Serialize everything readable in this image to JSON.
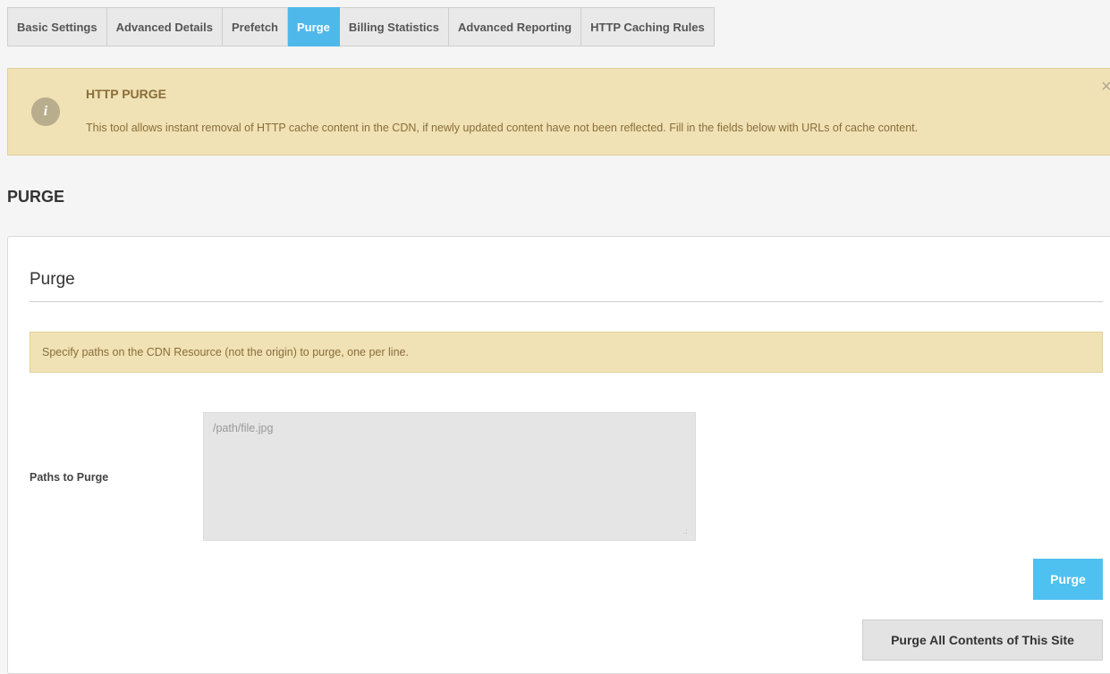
{
  "tabs": [
    {
      "label": "Basic Settings",
      "active": false
    },
    {
      "label": "Advanced Details",
      "active": false
    },
    {
      "label": "Prefetch",
      "active": false
    },
    {
      "label": "Purge",
      "active": true
    },
    {
      "label": "Billing Statistics",
      "active": false
    },
    {
      "label": "Advanced Reporting",
      "active": false
    },
    {
      "label": "HTTP Caching Rules",
      "active": false
    }
  ],
  "alert": {
    "icon": "info-icon",
    "icon_glyph": "i",
    "title": "HTTP PURGE",
    "text": "This tool allows instant removal of HTTP cache content in the CDN, if newly updated content have not been reflected. Fill in the fields below with URLs of cache content.",
    "close_glyph": "×"
  },
  "section_heading": "PURGE",
  "panel": {
    "title": "Purge",
    "note": "Specify paths on the CDN Resource (not the origin) to purge, one per line.",
    "paths_label": "Paths to Purge",
    "paths_value": "",
    "paths_placeholder": "/path/file.jpg",
    "purge_button": "Purge",
    "purge_all_button": "Purge All Contents of This Site"
  },
  "colors": {
    "active_tab": "#4fb8ea",
    "alert_bg": "#f0e2b4",
    "alert_text": "#8a6d3b",
    "purge_button": "#4fc1f0"
  }
}
